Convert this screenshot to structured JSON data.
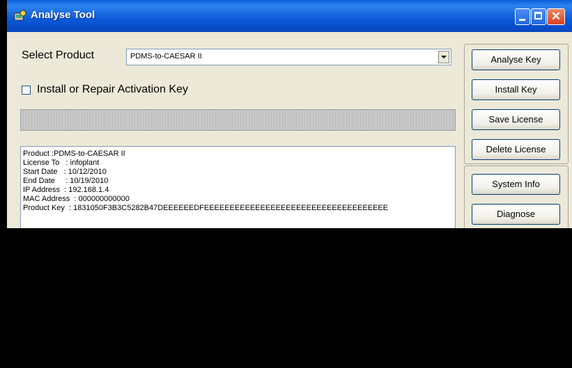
{
  "window": {
    "title": "Analyse Tool"
  },
  "form": {
    "select_product_label": "Select Product",
    "select_product_value": "PDMS-to-CAESAR II",
    "checkbox_label": "Install or Repair Activation Key"
  },
  "buttons": {
    "analyse_key": "Analyse Key",
    "install_key": "Install Key",
    "save_license": "Save License",
    "delete_license": "Delete License",
    "system_info": "System Info",
    "diagnose": "Diagnose"
  },
  "output_lines": [
    "Product :PDMS-to-CAESAR II",
    "License To   : infoplant",
    "Start Date   : 10/12/2010",
    "End Date     : 10/19/2010",
    "IP Address  : 192.168.1.4",
    "MAC Address  : 000000000000",
    "Product Key  : 1831050F3B3C5282B47DEEEEEEDFEEEEEEEEEEEEEEEEEEEEEEEEEEEEEEEEEEEE"
  ],
  "icons": {
    "app": "analyse-tool-app-icon",
    "minimize": "minimize-icon",
    "maximize": "maximize-icon",
    "close": "close-icon"
  }
}
